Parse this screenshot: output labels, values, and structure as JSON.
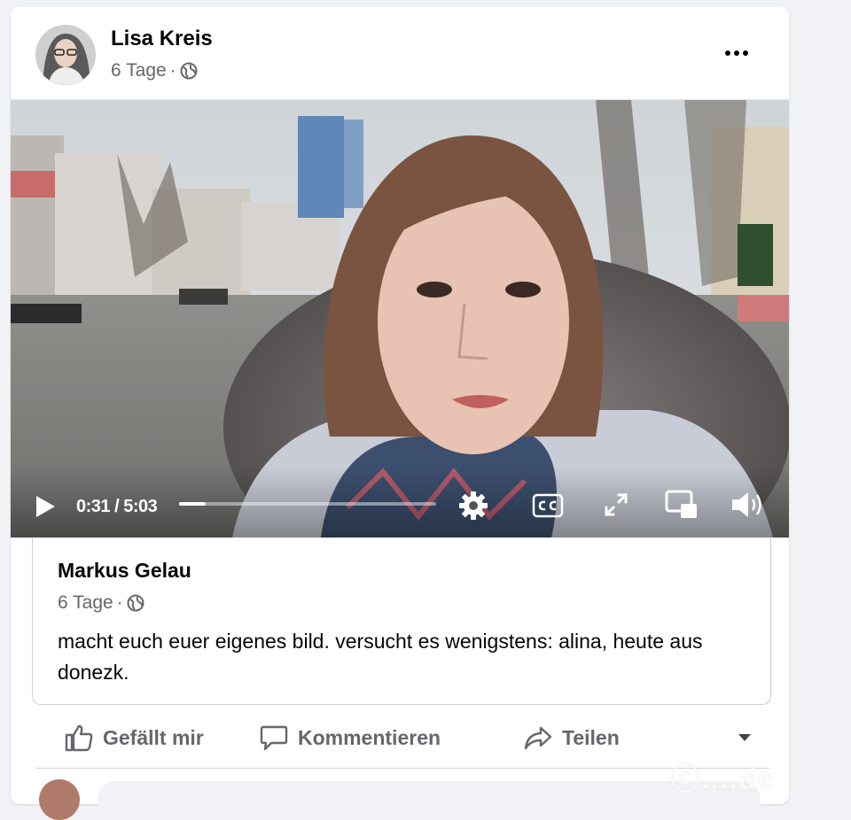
{
  "post": {
    "author_name": "Lisa Kreis",
    "time": "6 Tage",
    "separator": "·",
    "privacy_icon": "globe-icon"
  },
  "video": {
    "time_display": "0:31 / 5:03",
    "progress": 0.103
  },
  "shared_post": {
    "author_name": "Markus Gelau",
    "time": "6 Tage",
    "separator": "·",
    "text": "macht euch euer eigenes bild. versucht es wenigstens: alina, heute aus donezk."
  },
  "actions": {
    "like_label": "Gefällt mir",
    "comment_label": "Kommentieren",
    "share_label": "Teilen"
  },
  "watermark": "ⓒ....de",
  "colors": {
    "secondary_text": "#65676b",
    "background": "#f0f2f5",
    "card": "#ffffff"
  }
}
